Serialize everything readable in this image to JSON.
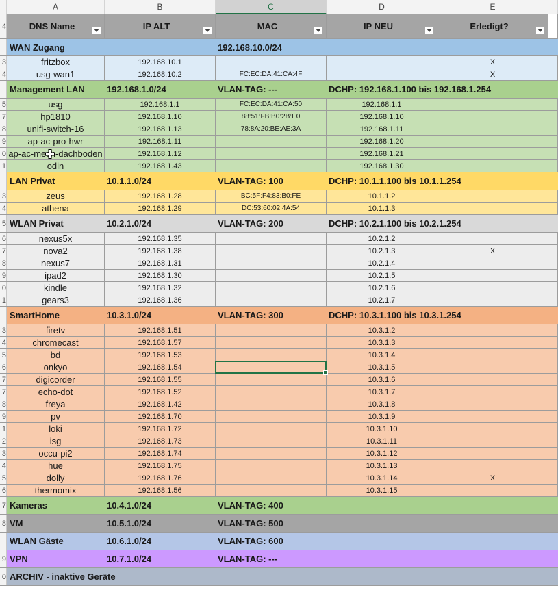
{
  "columns": [
    {
      "letter": "A",
      "selected": false
    },
    {
      "letter": "B",
      "selected": false
    },
    {
      "letter": "C",
      "selected": true
    },
    {
      "letter": "D",
      "selected": false
    },
    {
      "letter": "E",
      "selected": false
    }
  ],
  "header": {
    "row_number": "4",
    "cells": [
      "DNS Name",
      "IP ALT",
      "MAC",
      "IP NEU",
      "Erledigt?"
    ],
    "background": "#a5a5a5"
  },
  "section_colors": {
    "wan": "#9dc3e6",
    "mgmt": "#a9d08e",
    "lan": "#ffd966",
    "wlan": "#d9d9d9",
    "smart": "#f4b183",
    "kameras": "#a9d08e",
    "vm": "#a5a5a5",
    "gaeste": "#b4c6e7",
    "vpn": "#cc99ff",
    "archiv": "#adb9ca"
  },
  "row_colors": {
    "wan": "#ddebf7",
    "mgmt": "#c6e0b4",
    "lan": "#ffe699",
    "wlan": "#ededed",
    "smart": "#f8cbad"
  },
  "rows": [
    {
      "n": "",
      "type": "section",
      "group": "wan",
      "texts": [
        "WAN Zugang",
        "",
        "192.168.10.0/24",
        ""
      ]
    },
    {
      "n": "3",
      "type": "data",
      "group": "wan",
      "cells": [
        "fritzbox",
        "192.168.10.1",
        "",
        "",
        "X"
      ]
    },
    {
      "n": "4",
      "type": "data",
      "group": "wan",
      "cells": [
        "usg-wan1",
        "192.168.10.2",
        "FC:EC:DA:41:CA:4F",
        "",
        "X"
      ]
    },
    {
      "n": "",
      "type": "section",
      "group": "mgmt",
      "texts": [
        "Management LAN",
        "192.168.1.0/24",
        "VLAN-TAG: ---",
        "DCHP: 192.168.1.100 bis 192.168.1.254"
      ]
    },
    {
      "n": "5",
      "type": "data",
      "group": "mgmt",
      "cells": [
        "usg",
        "192.168.1.1",
        "FC:EC:DA:41:CA:50",
        "192.168.1.1",
        ""
      ]
    },
    {
      "n": "7",
      "type": "data",
      "group": "mgmt",
      "cells": [
        "hp1810",
        "192.168.1.10",
        "88:51:FB:B0:2B:E0",
        "192.168.1.10",
        ""
      ]
    },
    {
      "n": "8",
      "type": "data",
      "group": "mgmt",
      "cells": [
        "unifi-switch-16",
        "192.168.1.13",
        "78:8A:20:BE:AE:3A",
        "192.168.1.11",
        ""
      ]
    },
    {
      "n": "9",
      "type": "data",
      "group": "mgmt",
      "cells": [
        "ap-ac-pro-hwr",
        "192.168.1.11",
        "",
        "192.168.1.20",
        ""
      ]
    },
    {
      "n": "0",
      "type": "data",
      "group": "mgmt",
      "cells": [
        "ap-ac-mesh-dachboden",
        "192.168.1.12",
        "",
        "192.168.1.21",
        ""
      ]
    },
    {
      "n": "1",
      "type": "data",
      "group": "mgmt",
      "cells": [
        "odin",
        "192.168.1.43",
        "",
        "192.168.1.30",
        ""
      ]
    },
    {
      "n": "",
      "type": "section",
      "group": "lan",
      "texts": [
        "LAN Privat",
        "10.1.1.0/24",
        "VLAN-TAG: 100",
        "DCHP: 10.1.1.100 bis 10.1.1.254"
      ]
    },
    {
      "n": "3",
      "type": "data",
      "group": "lan",
      "cells": [
        "zeus",
        "192.168.1.28",
        "BC:5F:F4:83:B0:FE",
        "10.1.1.2",
        ""
      ]
    },
    {
      "n": "4",
      "type": "data",
      "group": "lan",
      "cells": [
        "athena",
        "192.168.1.29",
        "DC:53:60:02:4A:54",
        "10.1.1.3",
        ""
      ]
    },
    {
      "n": "5",
      "type": "section",
      "group": "wlan",
      "texts": [
        "WLAN Privat",
        "10.2.1.0/24",
        "VLAN-TAG: 200",
        "DCHP: 10.2.1.100 bis 10.2.1.254"
      ]
    },
    {
      "n": "6",
      "type": "data",
      "group": "wlan",
      "cells": [
        "nexus5x",
        "192.168.1.35",
        "",
        "10.2.1.2",
        ""
      ]
    },
    {
      "n": "7",
      "type": "data",
      "group": "wlan",
      "cells": [
        "nova2",
        "192.168.1.38",
        "",
        "10.2.1.3",
        "X"
      ]
    },
    {
      "n": "8",
      "type": "data",
      "group": "wlan",
      "cells": [
        "nexus7",
        "192.168.1.31",
        "",
        "10.2.1.4",
        ""
      ]
    },
    {
      "n": "9",
      "type": "data",
      "group": "wlan",
      "cells": [
        "ipad2",
        "192.168.1.30",
        "",
        "10.2.1.5",
        ""
      ]
    },
    {
      "n": "0",
      "type": "data",
      "group": "wlan",
      "cells": [
        "kindle",
        "192.168.1.32",
        "",
        "10.2.1.6",
        ""
      ]
    },
    {
      "n": "1",
      "type": "data",
      "group": "wlan",
      "cells": [
        "gears3",
        "192.168.1.36",
        "",
        "10.2.1.7",
        ""
      ]
    },
    {
      "n": "",
      "type": "section",
      "group": "smart",
      "texts": [
        "SmartHome",
        "10.3.1.0/24",
        "VLAN-TAG: 300",
        "DCHP: 10.3.1.100 bis 10.3.1.254"
      ]
    },
    {
      "n": "3",
      "type": "data",
      "group": "smart",
      "cells": [
        "firetv",
        "192.168.1.51",
        "",
        "10.3.1.2",
        ""
      ]
    },
    {
      "n": "4",
      "type": "data",
      "group": "smart",
      "cells": [
        "chromecast",
        "192.168.1.57",
        "",
        "10.3.1.3",
        ""
      ]
    },
    {
      "n": "5",
      "type": "data",
      "group": "smart",
      "cells": [
        "bd",
        "192.168.1.53",
        "",
        "10.3.1.4",
        ""
      ]
    },
    {
      "n": "6",
      "type": "data",
      "group": "smart",
      "cells": [
        "onkyo",
        "192.168.1.54",
        "",
        "10.3.1.5",
        ""
      ],
      "active_col": 2
    },
    {
      "n": "7",
      "type": "data",
      "group": "smart",
      "cells": [
        "digicorder",
        "192.168.1.55",
        "",
        "10.3.1.6",
        ""
      ]
    },
    {
      "n": "7",
      "type": "data",
      "group": "smart",
      "cells": [
        "echo-dot",
        "192.168.1.52",
        "",
        "10.3.1.7",
        ""
      ]
    },
    {
      "n": "8",
      "type": "data",
      "group": "smart",
      "cells": [
        "freya",
        "192.168.1.42",
        "",
        "10.3.1.8",
        ""
      ]
    },
    {
      "n": "9",
      "type": "data",
      "group": "smart",
      "cells": [
        "pv",
        "192.168.1.70",
        "",
        "10.3.1.9",
        ""
      ]
    },
    {
      "n": "1",
      "type": "data",
      "group": "smart",
      "cells": [
        "loki",
        "192.168.1.72",
        "",
        "10.3.1.10",
        ""
      ]
    },
    {
      "n": "2",
      "type": "data",
      "group": "smart",
      "cells": [
        "isg",
        "192.168.1.73",
        "",
        "10.3.1.11",
        ""
      ]
    },
    {
      "n": "3",
      "type": "data",
      "group": "smart",
      "cells": [
        "occu-pi2",
        "192.168.1.74",
        "",
        "10.3.1.12",
        ""
      ]
    },
    {
      "n": "4",
      "type": "data",
      "group": "smart",
      "cells": [
        "hue",
        "192.168.1.75",
        "",
        "10.3.1.13",
        ""
      ]
    },
    {
      "n": "5",
      "type": "data",
      "group": "smart",
      "cells": [
        "dolly",
        "192.168.1.76",
        "",
        "10.3.1.14",
        "X"
      ]
    },
    {
      "n": "6",
      "type": "data",
      "group": "smart",
      "cells": [
        "thermomix",
        "192.168.1.56",
        "",
        "10.3.1.15",
        ""
      ]
    },
    {
      "n": "7",
      "type": "section",
      "group": "kameras",
      "texts": [
        "Kameras",
        "10.4.1.0/24",
        "VLAN-TAG: 400",
        ""
      ]
    },
    {
      "n": "8",
      "type": "section",
      "group": "vm",
      "texts": [
        "VM",
        "10.5.1.0/24",
        "VLAN-TAG: 500",
        ""
      ]
    },
    {
      "n": "",
      "type": "section",
      "group": "gaeste",
      "texts": [
        "WLAN Gäste",
        "10.6.1.0/24",
        "VLAN-TAG: 600",
        ""
      ]
    },
    {
      "n": "9",
      "type": "section",
      "group": "vpn",
      "texts": [
        "VPN",
        "10.7.1.0/24",
        "VLAN-TAG: ---",
        ""
      ]
    },
    {
      "n": "0",
      "type": "section",
      "group": "archiv",
      "texts": [
        "ARCHIV - inaktive Geräte",
        "",
        "",
        ""
      ]
    }
  ]
}
